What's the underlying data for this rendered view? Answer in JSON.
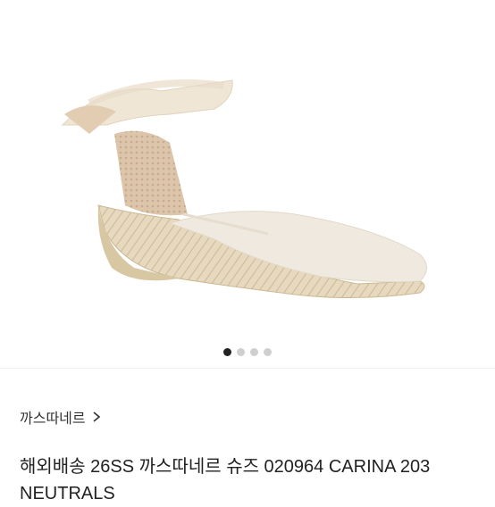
{
  "gallery": {
    "image_alt": "product-photo-espadrille-wedge",
    "pager": {
      "total": 4,
      "active_index": 0
    }
  },
  "brand": {
    "label": "까스따네르",
    "icon": "chevron-right-icon"
  },
  "product": {
    "title": "해외배송 26SS 까스따네르 슈즈 020964 CARINA 203 NEUTRALS"
  },
  "colors": {
    "dot_active": "#222222",
    "dot_inactive": "#cfcfcf",
    "text": "#222222"
  }
}
